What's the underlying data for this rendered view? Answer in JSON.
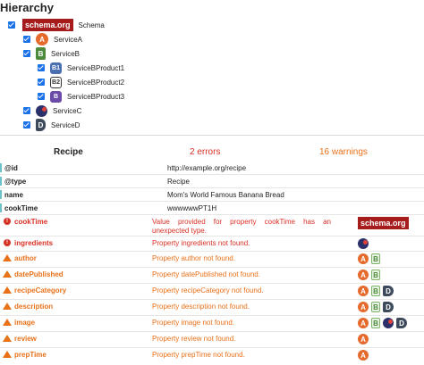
{
  "hierarchy": {
    "title": "Hierarchy",
    "schema_logo": "schema.org",
    "schema_label": "Schema",
    "nodes": [
      {
        "label": "ServiceA",
        "icon": "A"
      },
      {
        "label": "ServiceB",
        "icon": "B"
      },
      {
        "label": "ServiceBProduct1",
        "icon": "B1"
      },
      {
        "label": "ServiceBProduct2",
        "icon": "B2"
      },
      {
        "label": "ServiceBProduct3",
        "icon": "B"
      },
      {
        "label": "ServiceC",
        "icon": "C"
      },
      {
        "label": "ServiceD",
        "icon": "D"
      }
    ]
  },
  "validation": {
    "type": "Recipe",
    "errors": "2 errors",
    "warnings": "16 warnings",
    "rows": [
      {
        "key": "@id",
        "value": "http://example.org/recipe"
      },
      {
        "key": "@type",
        "value": "Recipe"
      },
      {
        "key": "name",
        "value": "Mom's World Famous Banana Bread"
      },
      {
        "key": "cookTime",
        "value": "wwwwwwPT1H"
      },
      {
        "key": "cookTime",
        "value": "Value provided for property cookTime has an unexpected type."
      },
      {
        "key": "ingredients",
        "value": "Property ingredients not found."
      },
      {
        "key": "author",
        "value": "Property author not found."
      },
      {
        "key": "datePublished",
        "value": "Property datePublished not found."
      },
      {
        "key": "recipeCategory",
        "value": "Property recipeCategory not found."
      },
      {
        "key": "description",
        "value": "Property description not found."
      },
      {
        "key": "image",
        "value": "Property image not found."
      },
      {
        "key": "review",
        "value": "Property review not found."
      },
      {
        "key": "prepTime",
        "value": "Property prepTime not found."
      }
    ],
    "icon_letters": {
      "a": "A",
      "b": "B",
      "d": "D"
    }
  },
  "colors": {
    "error": "#d93025",
    "warning": "#e8711a",
    "schema_brand": "#a61c1c",
    "checkbox": "#1a73e8"
  }
}
